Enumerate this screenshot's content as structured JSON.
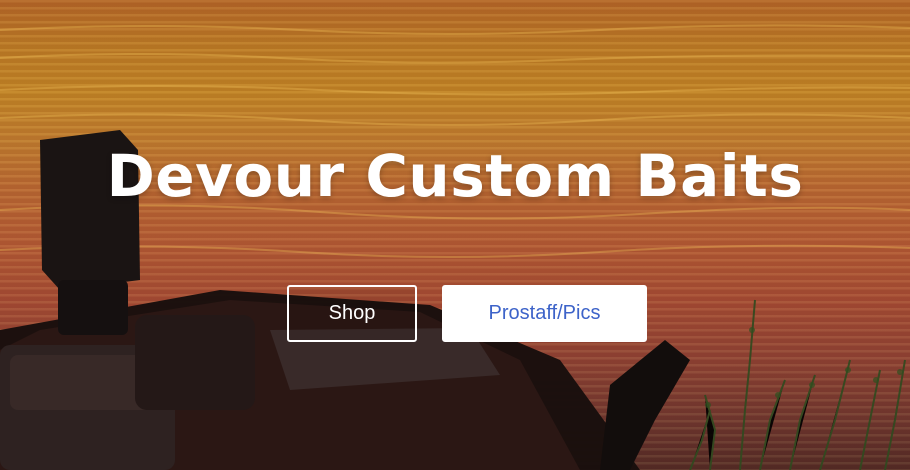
{
  "hero": {
    "title": "Devour Custom Baits",
    "buttons": {
      "shop_label": "Shop",
      "prostaff_label": "Prostaff/Pics"
    }
  },
  "colors": {
    "button_text_primary": "#3d63c9",
    "button_background": "#ffffff",
    "title_text": "#ffffff"
  }
}
